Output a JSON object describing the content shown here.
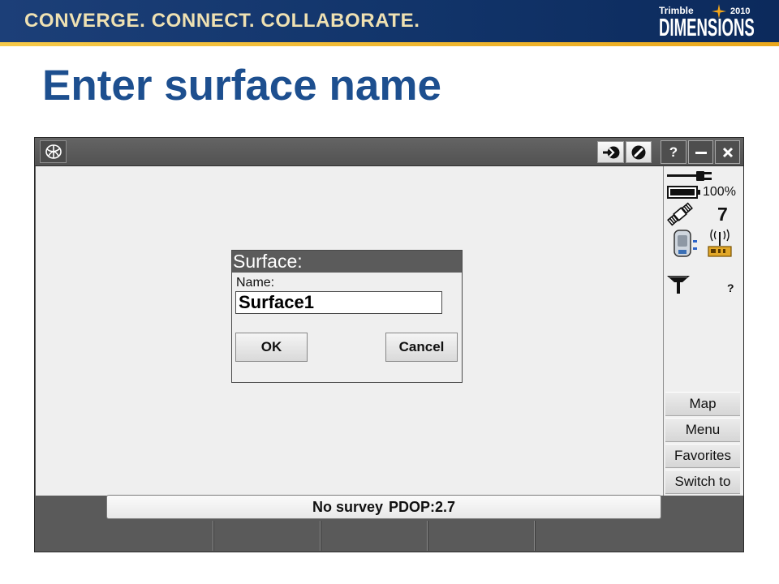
{
  "slide": {
    "banner": {
      "tagline": "CONVERGE. CONNECT. COLLABORATE."
    },
    "logo": {
      "brand": "Trimble",
      "year": "2010",
      "event": "DIMENSIONS",
      "star_icon": "star-icon"
    },
    "title": "Enter surface name"
  },
  "app": {
    "titlebar": {
      "menu_icon": "trimble-globe-icon",
      "tool_icons": [
        "switch-arrow-icon",
        "pencil-circle-icon"
      ],
      "help_icon": "help-icon",
      "help_label": "?",
      "minimize_icon": "minimize-icon",
      "close_icon": "close-icon"
    },
    "status_panel": {
      "power_icon": "power-plug-icon",
      "battery_icon": "battery-icon",
      "battery_level": "100%",
      "satellite_icon": "satellite-icon",
      "satellite_count": "7",
      "receiver_icon": "gnss-receiver-icon",
      "radio_icon": "radio-icon",
      "antenna_icon": "antenna-icon",
      "antenna_status": "?"
    },
    "sidebar_buttons": [
      {
        "label": "Map"
      },
      {
        "label": "Menu"
      },
      {
        "label": "Favorites"
      },
      {
        "label": "Switch to"
      }
    ],
    "dialog": {
      "title": "Surface:",
      "field_label": "Name:",
      "field_value": "Surface1",
      "ok_label": "OK",
      "cancel_label": "Cancel"
    },
    "status_line": {
      "survey": "No survey",
      "pdop": "PDOP:2.7"
    }
  },
  "colors": {
    "banner": "#14366c",
    "stripe": "#f0b323",
    "title": "#1d4f8f",
    "chrome": "#5a5a5a",
    "panel": "#efefef",
    "radio": "#e2a829"
  }
}
